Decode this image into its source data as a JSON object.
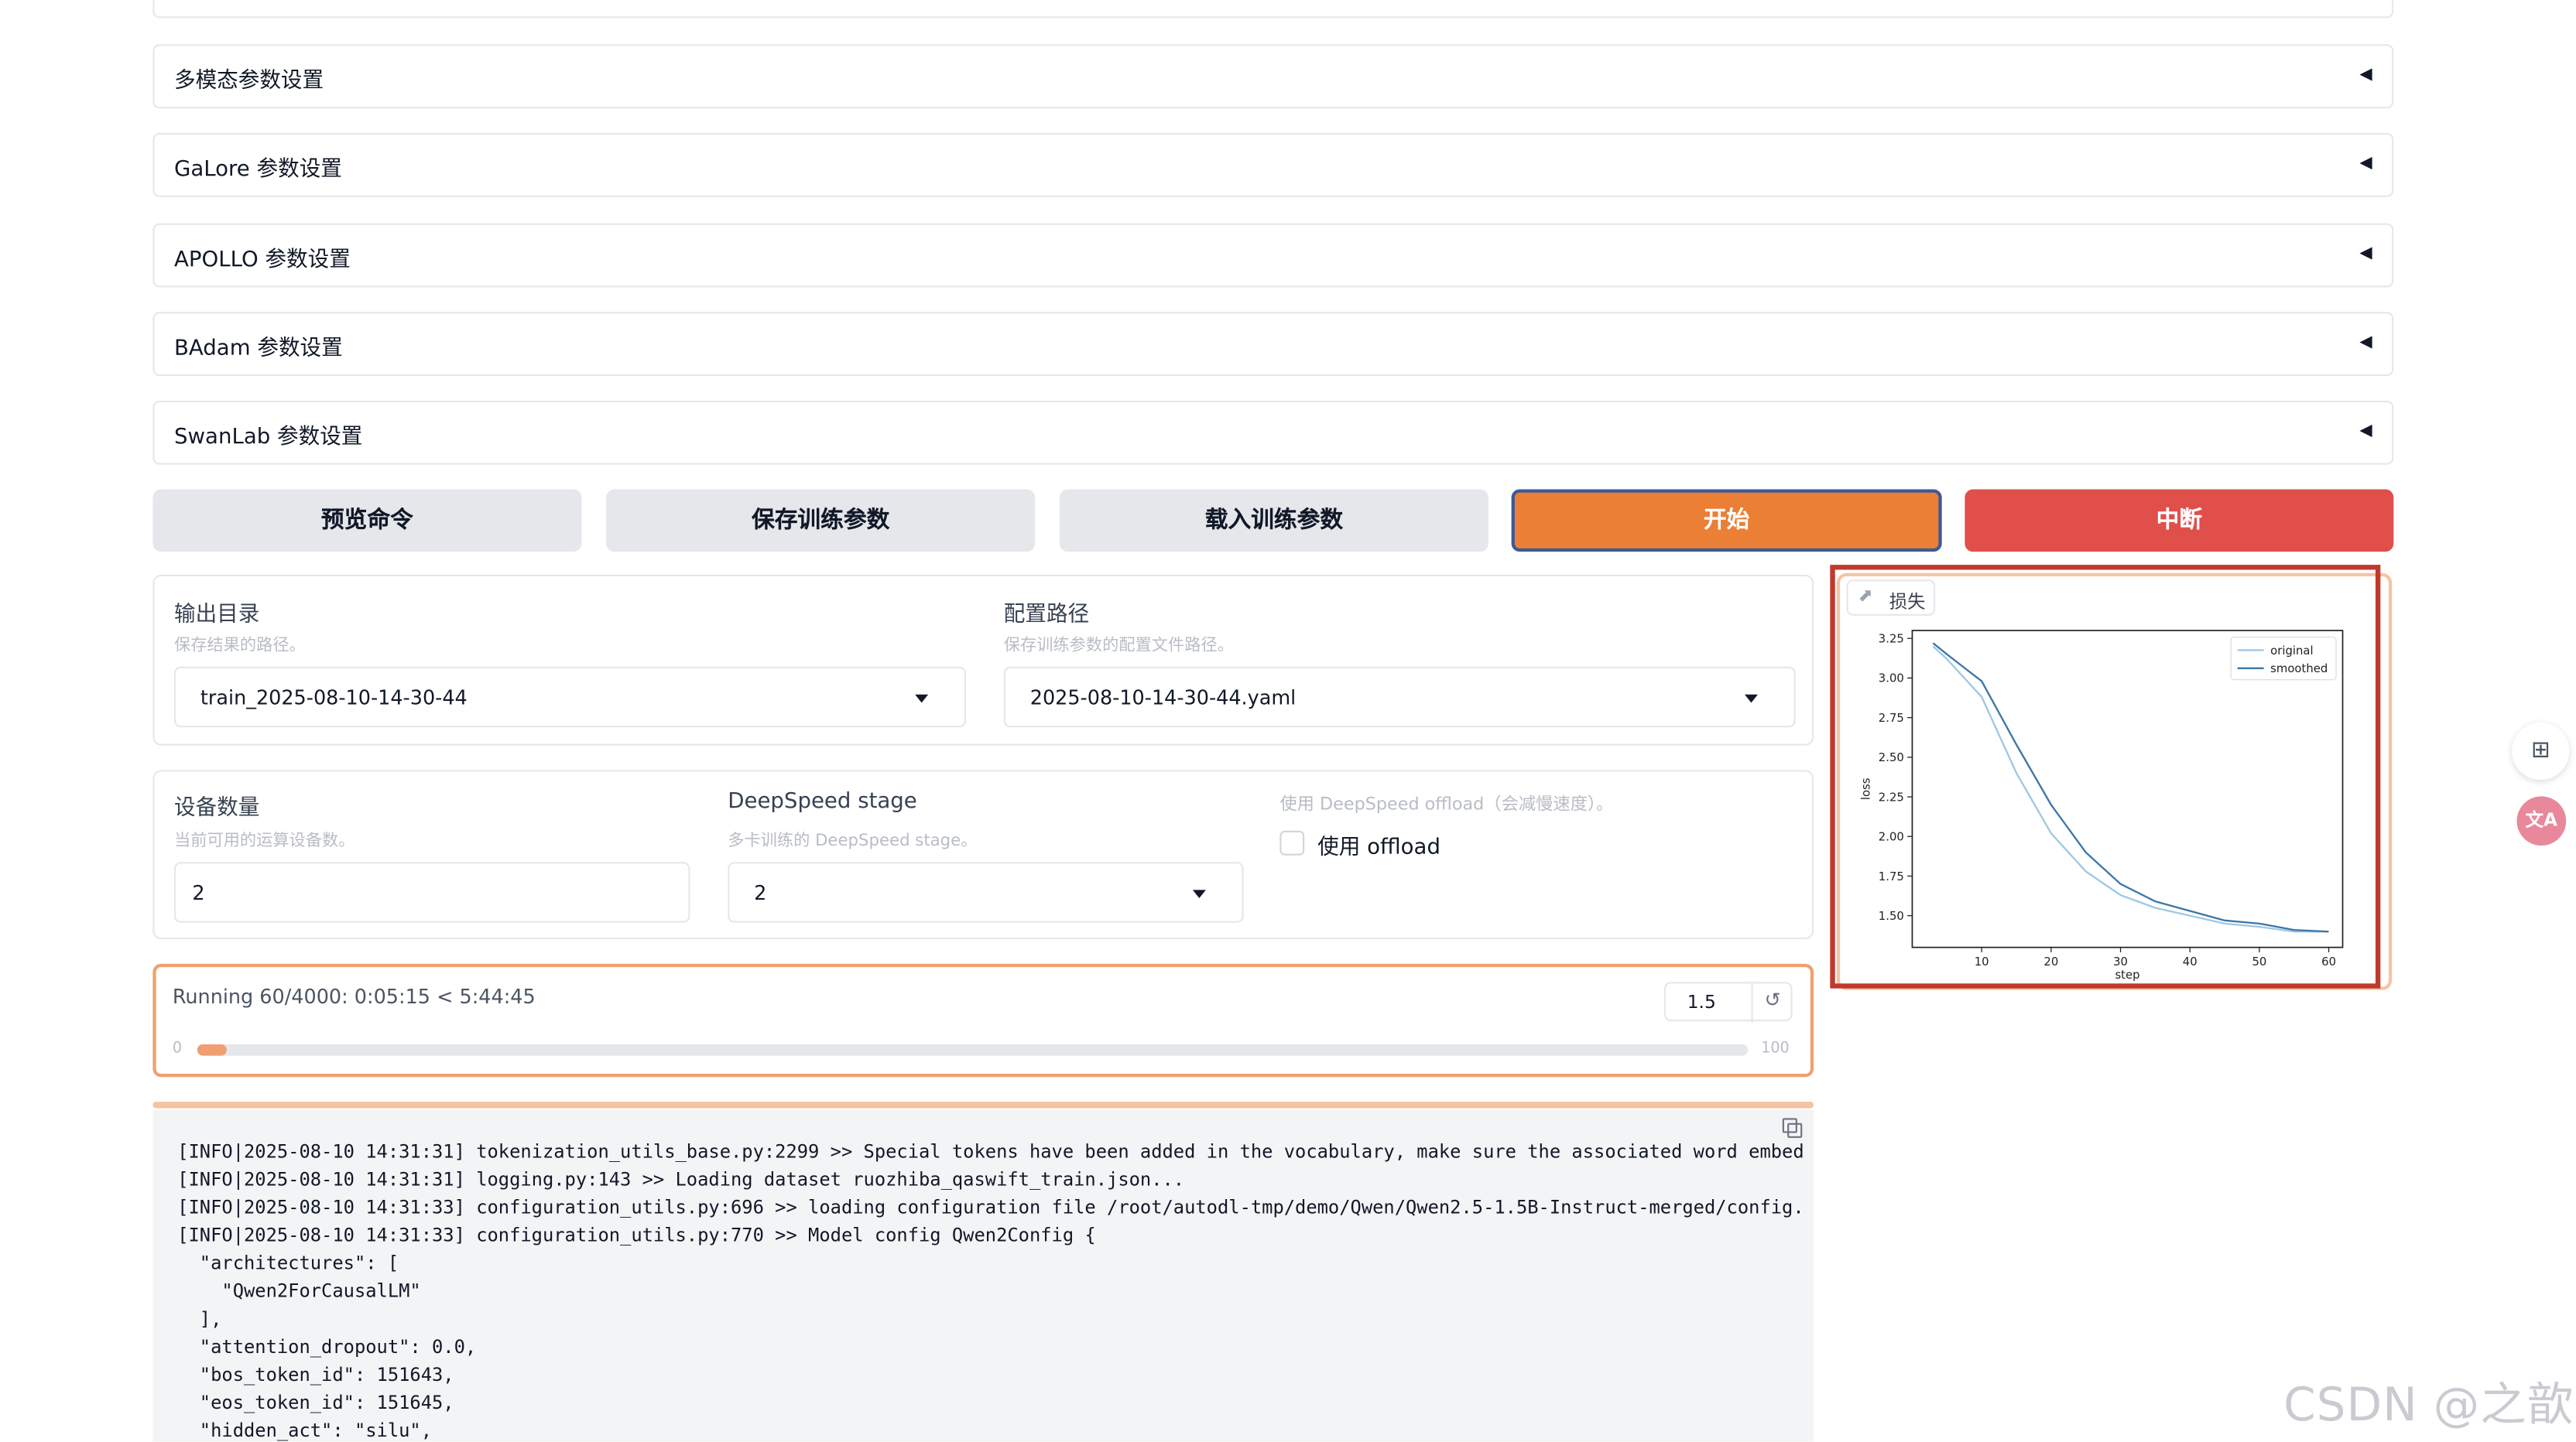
{
  "accordions": [
    {
      "label": "多模态参数设置"
    },
    {
      "label": "GaLore 参数设置"
    },
    {
      "label": "APOLLO 参数设置"
    },
    {
      "label": "BAdam 参数设置"
    },
    {
      "label": "SwanLab 参数设置"
    }
  ],
  "accordion_arrow": "◀",
  "buttons": {
    "preview": "预览命令",
    "save": "保存训练参数",
    "load": "载入训练参数",
    "start": "开始",
    "abort": "中断"
  },
  "output": {
    "dir_label": "输出目录",
    "dir_info": "保存结果的路径。",
    "dir_value": "train_2025-08-10-14-30-44",
    "config_label": "配置路径",
    "config_info": "保存训练参数的配置文件路径。",
    "config_value": "2025-08-10-14-30-44.yaml"
  },
  "device": {
    "count_label": "设备数量",
    "count_info": "当前可用的运算设备数。",
    "count_value": "2",
    "ds_label": "DeepSpeed stage",
    "ds_info": "多卡训练的 DeepSpeed stage。",
    "ds_value": "2",
    "offload_info": "使用 DeepSpeed offload（会减慢速度）。",
    "offload_label": "使用 offload",
    "offload_checked": false
  },
  "progress": {
    "status": "Running 60/4000: 0:05:15 < 5:44:45",
    "min": "0",
    "max": "100",
    "value": "1.5",
    "fraction": 0.015
  },
  "loss_panel": {
    "title": "损失"
  },
  "chart_data": {
    "type": "line",
    "xlabel": "step",
    "ylabel": "loss",
    "xlim": [
      0,
      62
    ],
    "ylim": [
      1.3,
      3.3
    ],
    "xticks": [
      10,
      20,
      30,
      40,
      50,
      60
    ],
    "yticks": [
      1.5,
      1.75,
      2.0,
      2.25,
      2.5,
      2.75,
      3.0,
      3.25
    ],
    "ytick_labels": [
      "1.50",
      "1.75",
      "2.00",
      "2.25",
      "2.50",
      "2.75",
      "3.00",
      "3.25"
    ],
    "legend_position": "top-right",
    "series": [
      {
        "name": "original",
        "color": "#9ec8e2",
        "x": [
          3,
          5,
          10,
          15,
          20,
          25,
          30,
          35,
          40,
          45,
          50,
          55,
          60
        ],
        "y": [
          3.2,
          3.12,
          2.88,
          2.4,
          2.02,
          1.78,
          1.63,
          1.55,
          1.5,
          1.45,
          1.43,
          1.4,
          1.4
        ]
      },
      {
        "name": "smoothed",
        "color": "#3b76a8",
        "x": [
          3,
          5,
          10,
          15,
          20,
          25,
          30,
          35,
          40,
          45,
          50,
          55,
          60
        ],
        "y": [
          3.22,
          3.15,
          2.98,
          2.58,
          2.2,
          1.9,
          1.7,
          1.59,
          1.53,
          1.47,
          1.45,
          1.41,
          1.4
        ]
      }
    ]
  },
  "log_lines": [
    "[INFO|2025-08-10 14:31:31] tokenization_utils_base.py:2299 >> Special tokens have been added in the vocabulary, make sure the associated word embed",
    "[INFO|2025-08-10 14:31:31] logging.py:143 >> Loading dataset ruozhiba_qaswift_train.json...",
    "[INFO|2025-08-10 14:31:33] configuration_utils.py:696 >> loading configuration file /root/autodl-tmp/demo/Qwen/Qwen2.5-1.5B-Instruct-merged/config.",
    "[INFO|2025-08-10 14:31:33] configuration_utils.py:770 >> Model config Qwen2Config {",
    "  \"architectures\": [",
    "    \"Qwen2ForCausalLM\"",
    "  ],",
    "  \"attention_dropout\": 0.0,",
    "  \"bos_token_id\": 151643,",
    "  \"eos_token_id\": 151645,",
    "  \"hidden_act\": \"silu\","
  ],
  "watermark": "CSDN @之歆",
  "colors": {
    "accent": "#ea7f35",
    "danger": "#e04f4a",
    "highlight_box": "#c0392b"
  }
}
